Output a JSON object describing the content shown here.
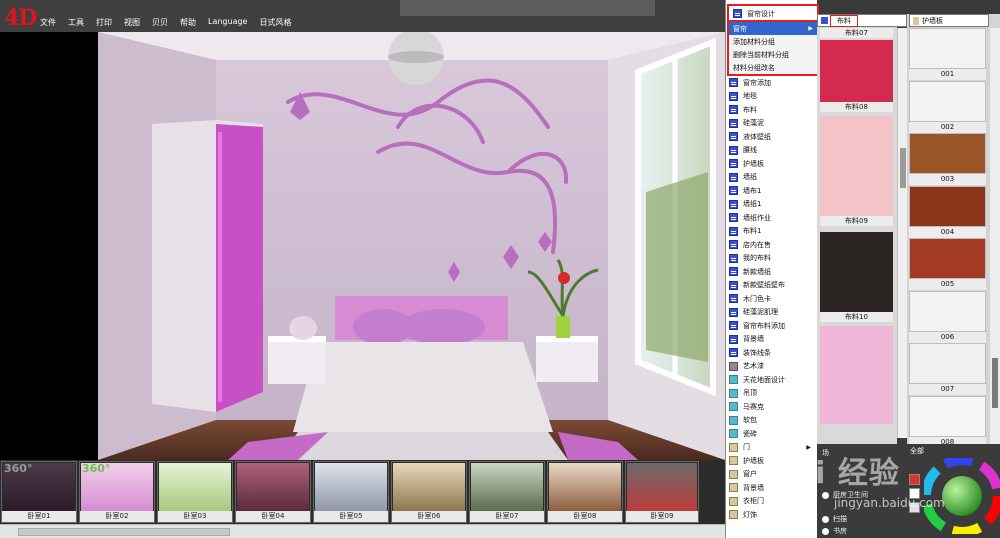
{
  "app": {
    "logo": "4D",
    "menus": [
      "文件",
      "工具",
      "打印",
      "视图",
      "贝贝",
      "帮助",
      "Language",
      "日式风格"
    ]
  },
  "scene_thumbs": [
    {
      "label": "卧室01",
      "deg": "360°"
    },
    {
      "label": "卧室02",
      "deg": "360°"
    },
    {
      "label": "卧室03",
      "deg": ""
    },
    {
      "label": "卧室04",
      "deg": ""
    },
    {
      "label": "卧室05",
      "deg": ""
    },
    {
      "label": "卧室06",
      "deg": ""
    },
    {
      "label": "卧室07",
      "deg": ""
    },
    {
      "label": "卧室08",
      "deg": ""
    },
    {
      "label": "卧室09",
      "deg": ""
    }
  ],
  "category_list": {
    "top_item": "窗帘设计",
    "context_menu": [
      {
        "label": "窗帘",
        "selected": true
      },
      {
        "label": "添加材料分组",
        "selected": false
      },
      {
        "label": "删除当前材料分组",
        "selected": false
      },
      {
        "label": "材料分组改名",
        "selected": false
      }
    ],
    "items": [
      {
        "label": "窗帘添加",
        "icon": "house-icon",
        "color": "blue"
      },
      {
        "label": "地毯",
        "icon": "grid-icon",
        "color": "blue"
      },
      {
        "label": "布料",
        "icon": "grid-icon",
        "color": "blue"
      },
      {
        "label": "硅藻泥",
        "icon": "grid-icon",
        "color": "blue"
      },
      {
        "label": "液体壁纸",
        "icon": "grid-icon",
        "color": "blue"
      },
      {
        "label": "腰线",
        "icon": "grid-icon",
        "color": "blue"
      },
      {
        "label": "护墙板",
        "icon": "grid-icon",
        "color": "blue"
      },
      {
        "label": "墙纸",
        "icon": "grid-icon",
        "color": "blue"
      },
      {
        "label": "墙布1",
        "icon": "grid-icon",
        "color": "blue"
      },
      {
        "label": "墙纸1",
        "icon": "grid-icon",
        "color": "blue"
      },
      {
        "label": "墙纸作业",
        "icon": "grid-icon",
        "color": "blue"
      },
      {
        "label": "布料1",
        "icon": "grid-icon",
        "color": "blue"
      },
      {
        "label": "店内在售",
        "icon": "grid-icon",
        "color": "blue"
      },
      {
        "label": "我的布料",
        "icon": "grid-icon",
        "color": "blue"
      },
      {
        "label": "新款墙纸",
        "icon": "grid-icon",
        "color": "blue"
      },
      {
        "label": "新款壁纸壁布",
        "icon": "grid-icon",
        "color": "blue"
      },
      {
        "label": "木门色卡",
        "icon": "grid-icon",
        "color": "blue"
      },
      {
        "label": "硅藻泥肌理",
        "icon": "grid-icon",
        "color": "blue"
      },
      {
        "label": "窗帘布料添加",
        "icon": "grid-icon",
        "color": "blue"
      },
      {
        "label": "背景墙",
        "icon": "grid-icon",
        "color": "blue"
      },
      {
        "label": "装饰线条",
        "icon": "grid-icon",
        "color": "blue"
      },
      {
        "label": "艺术漆",
        "icon": "grey-square-icon",
        "color": "grey"
      },
      {
        "label": "天花地面设计",
        "icon": "teal-grid-icon",
        "color": "teal"
      },
      {
        "label": "吊顶",
        "icon": "teal-grid-icon",
        "color": "teal"
      },
      {
        "label": "马赛克",
        "icon": "teal-grid-icon",
        "color": "teal"
      },
      {
        "label": "软包",
        "icon": "teal-grid-icon",
        "color": "teal"
      },
      {
        "label": "瓷砖",
        "icon": "teal-grid-icon",
        "color": "teal"
      },
      {
        "label": "门",
        "icon": "door-icon",
        "color": "tan",
        "submenu": true
      },
      {
        "label": "护墙板",
        "icon": "door-icon",
        "color": "tan"
      },
      {
        "label": "窗户",
        "icon": "door-icon",
        "color": "tan"
      },
      {
        "label": "背景墙",
        "icon": "door-icon",
        "color": "tan"
      },
      {
        "label": "衣柜门",
        "icon": "door-icon",
        "color": "tan"
      },
      {
        "label": "灯饰",
        "icon": "lamp-icon",
        "color": "tan"
      }
    ]
  },
  "materials": {
    "tab_label": "布料",
    "items": [
      "布料07",
      "布料08",
      "布料09",
      "布料10",
      ""
    ],
    "colors": [
      "#d84a6a",
      "#d42a4e",
      "#f2c4c8",
      "#2a2522",
      "#f0b6d8"
    ]
  },
  "panels": {
    "tab_label": "护墙板",
    "items": [
      "001",
      "002",
      "003",
      "004",
      "005",
      "006",
      "007",
      "008"
    ],
    "colors": [
      "#f2f2f2",
      "#f4f4f4",
      "#9a5628",
      "#8a3418",
      "#a33a22",
      "#f3f3f3",
      "#f0f0f0",
      "#f5f5f5"
    ]
  },
  "rooms": {
    "items": [
      "场",
      "厨房卫生间",
      "扫描",
      "书房"
    ]
  },
  "color_panel": {
    "label": "全部",
    "swatches": [
      "#e03030",
      "#ffffff",
      "#e0e0e0"
    ]
  },
  "watermark": {
    "main": "Bai 经验",
    "sub": "jingyan.baidu.com"
  }
}
